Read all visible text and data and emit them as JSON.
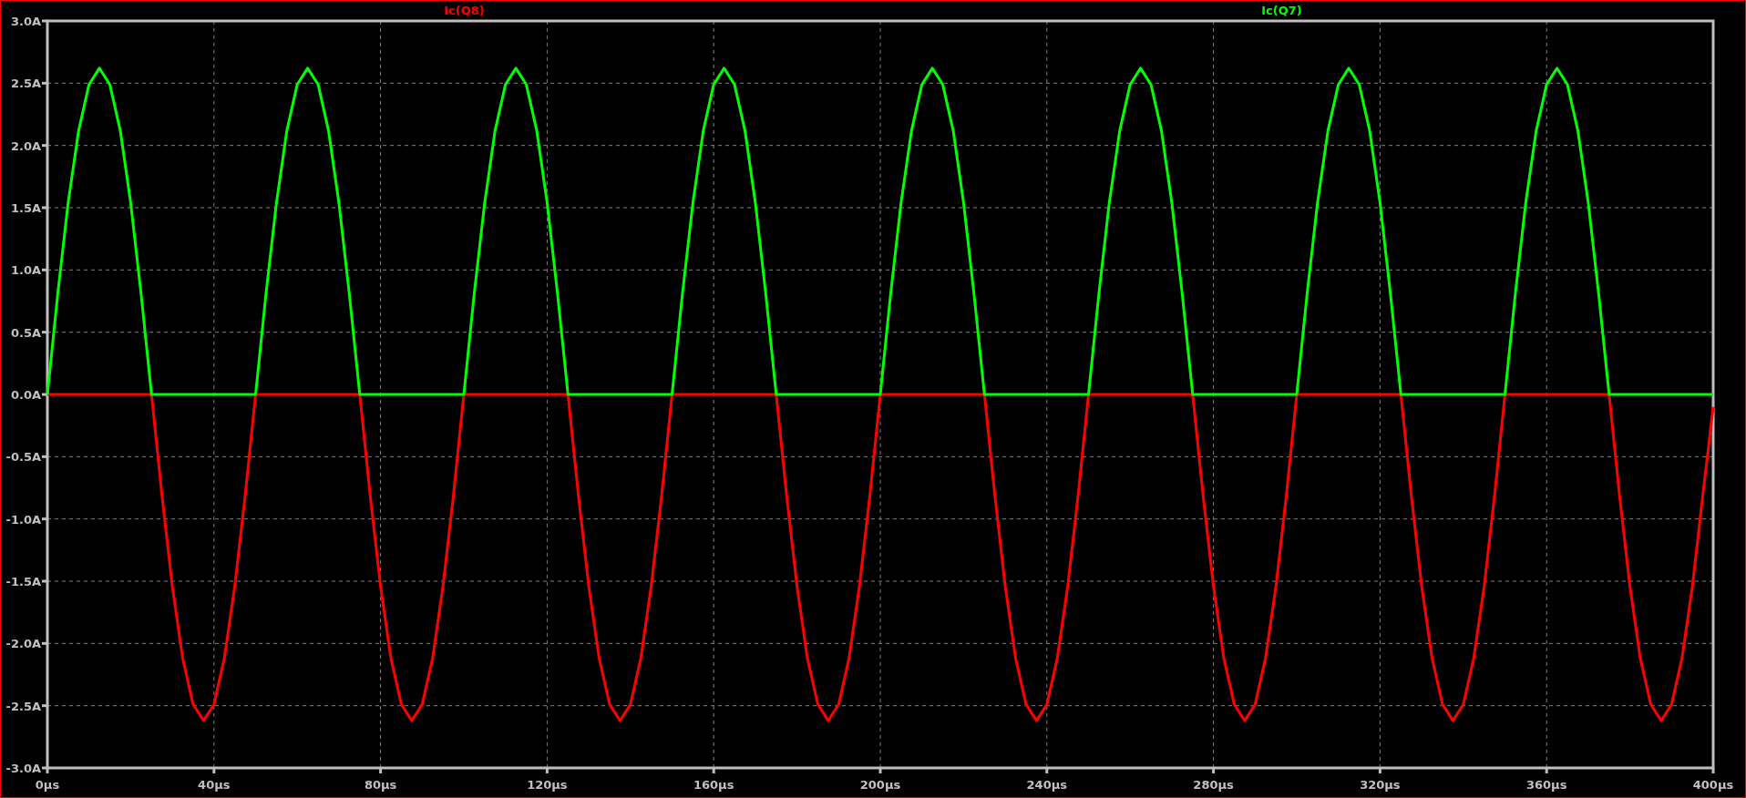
{
  "plot": {
    "chart_data": {
      "type": "line",
      "x": [
        0,
        2.5,
        5,
        7.5,
        10,
        12.5,
        15,
        17.5,
        20,
        22.5,
        25,
        27.5,
        30,
        32.5,
        35,
        37.5,
        40,
        42.5,
        45,
        47.5,
        50,
        52.5,
        55,
        57.5,
        60,
        62.5,
        65,
        67.5,
        70,
        72.5,
        75,
        77.5,
        80,
        82.5,
        85,
        87.5,
        90,
        92.5,
        95,
        97.5,
        100,
        102.5,
        105,
        107.5,
        110,
        112.5,
        115,
        117.5,
        120,
        122.5,
        125,
        127.5,
        130,
        132.5,
        135,
        137.5,
        140,
        142.5,
        145,
        147.5,
        150,
        152.5,
        155,
        157.5,
        160,
        162.5,
        165,
        167.5,
        170,
        172.5,
        175,
        177.5,
        180,
        182.5,
        185,
        187.5,
        190,
        192.5,
        195,
        197.5,
        200,
        202.5,
        205,
        207.5,
        210,
        212.5,
        215,
        217.5,
        220,
        222.5,
        225,
        227.5,
        230,
        232.5,
        235,
        237.5,
        240,
        242.5,
        245,
        247.5,
        250,
        252.5,
        255,
        257.5,
        260,
        262.5,
        265,
        267.5,
        270,
        272.5,
        275,
        277.5,
        280,
        282.5,
        285,
        287.5,
        290,
        292.5,
        295,
        297.5,
        300,
        302.5,
        305,
        307.5,
        310,
        312.5,
        315,
        317.5,
        320,
        322.5,
        325,
        327.5,
        330,
        332.5,
        335,
        337.5,
        340,
        342.5,
        345,
        347.5,
        350,
        352.5,
        355,
        357.5,
        360,
        362.5,
        365,
        367.5,
        370,
        372.5,
        375,
        377.5,
        380,
        382.5,
        385,
        387.5,
        390,
        392.5,
        395,
        397.5,
        400
      ],
      "series": [
        {
          "name": "Ic(Q8)",
          "color": "#ff0000",
          "values": [
            0,
            0,
            0,
            0,
            0,
            0,
            0,
            0,
            0,
            0,
            0,
            -0.81,
            -1.54,
            -2.12,
            -2.49,
            -2.62,
            -2.49,
            -2.12,
            -1.54,
            -0.81,
            0,
            0,
            0,
            0,
            0,
            0,
            0,
            0,
            0,
            0,
            0,
            -0.81,
            -1.54,
            -2.12,
            -2.49,
            -2.62,
            -2.49,
            -2.12,
            -1.54,
            -0.81,
            0,
            0,
            0,
            0,
            0,
            0,
            0,
            0,
            0,
            0,
            0,
            -0.81,
            -1.54,
            -2.12,
            -2.49,
            -2.62,
            -2.49,
            -2.12,
            -1.54,
            -0.81,
            0,
            0,
            0,
            0,
            0,
            0,
            0,
            0,
            0,
            0,
            0,
            -0.81,
            -1.54,
            -2.12,
            -2.49,
            -2.62,
            -2.49,
            -2.12,
            -1.54,
            -0.81,
            0,
            0,
            0,
            0,
            0,
            0,
            0,
            0,
            0,
            0,
            0,
            -0.81,
            -1.54,
            -2.12,
            -2.49,
            -2.62,
            -2.49,
            -2.12,
            -1.54,
            -0.81,
            0,
            0,
            0,
            0,
            0,
            0,
            0,
            0,
            0,
            0,
            0,
            -0.81,
            -1.54,
            -2.12,
            -2.49,
            -2.62,
            -2.49,
            -2.12,
            -1.54,
            -0.81,
            0,
            0,
            0,
            0,
            0,
            0,
            0,
            0,
            0,
            0,
            0,
            -0.81,
            -1.54,
            -2.12,
            -2.49,
            -2.62,
            -2.49,
            -2.12,
            -1.54,
            -0.81,
            0,
            0,
            0,
            0,
            0,
            0,
            0,
            0,
            0,
            0,
            0,
            -0.81,
            -1.54,
            -2.12,
            -2.49,
            -2.62,
            -2.49,
            -2.12,
            -1.54,
            -0.81,
            -0.1
          ]
        },
        {
          "name": "Ic(Q7)",
          "color": "#00ff00",
          "values": [
            0,
            0.81,
            1.54,
            2.12,
            2.49,
            2.62,
            2.49,
            2.12,
            1.54,
            0.81,
            0,
            0,
            0,
            0,
            0,
            0,
            0,
            0,
            0,
            0,
            0,
            0.81,
            1.54,
            2.12,
            2.49,
            2.62,
            2.49,
            2.12,
            1.54,
            0.81,
            0,
            0,
            0,
            0,
            0,
            0,
            0,
            0,
            0,
            0,
            0,
            0.81,
            1.54,
            2.12,
            2.49,
            2.62,
            2.49,
            2.12,
            1.54,
            0.81,
            0,
            0,
            0,
            0,
            0,
            0,
            0,
            0,
            0,
            0,
            0,
            0.81,
            1.54,
            2.12,
            2.49,
            2.62,
            2.49,
            2.12,
            1.54,
            0.81,
            0,
            0,
            0,
            0,
            0,
            0,
            0,
            0,
            0,
            0,
            0,
            0.81,
            1.54,
            2.12,
            2.49,
            2.62,
            2.49,
            2.12,
            1.54,
            0.81,
            0,
            0,
            0,
            0,
            0,
            0,
            0,
            0,
            0,
            0,
            0,
            0.81,
            1.54,
            2.12,
            2.49,
            2.62,
            2.49,
            2.12,
            1.54,
            0.81,
            0,
            0,
            0,
            0,
            0,
            0,
            0,
            0,
            0,
            0,
            0,
            0.81,
            1.54,
            2.12,
            2.49,
            2.62,
            2.49,
            2.12,
            1.54,
            0.81,
            0,
            0,
            0,
            0,
            0,
            0,
            0,
            0,
            0,
            0,
            0,
            0.81,
            1.54,
            2.12,
            2.49,
            2.62,
            2.49,
            2.12,
            1.54,
            0.81,
            0,
            0,
            0,
            0,
            0,
            0,
            0,
            0,
            0,
            0,
            0
          ]
        }
      ],
      "xlim": [
        0,
        400
      ],
      "ylim": [
        -3,
        3
      ],
      "grid": true,
      "xticks": [
        {
          "value": 0,
          "label": "0µs"
        },
        {
          "value": 40,
          "label": "40µs"
        },
        {
          "value": 80,
          "label": "80µs"
        },
        {
          "value": 120,
          "label": "120µs"
        },
        {
          "value": 160,
          "label": "160µs"
        },
        {
          "value": 200,
          "label": "200µs"
        },
        {
          "value": 240,
          "label": "240µs"
        },
        {
          "value": 280,
          "label": "280µs"
        },
        {
          "value": 320,
          "label": "320µs"
        },
        {
          "value": 360,
          "label": "360µs"
        },
        {
          "value": 400,
          "label": "400µs"
        }
      ],
      "yticks": [
        {
          "value": 3,
          "label": "3.0A"
        },
        {
          "value": 2.5,
          "label": "2.5A"
        },
        {
          "value": 2,
          "label": "2.0A"
        },
        {
          "value": 1.5,
          "label": "1.5A"
        },
        {
          "value": 1,
          "label": "1.0A"
        },
        {
          "value": 0.5,
          "label": "0.5A"
        },
        {
          "value": 0,
          "label": "0.0A"
        },
        {
          "value": -0.5,
          "label": "-0.5A"
        },
        {
          "value": -1,
          "label": "-1.0A"
        },
        {
          "value": -1.5,
          "label": "-1.5A"
        },
        {
          "value": -2,
          "label": "-2.0A"
        },
        {
          "value": -2.5,
          "label": "-2.5A"
        },
        {
          "value": -3,
          "label": "-3.0A"
        }
      ]
    }
  }
}
